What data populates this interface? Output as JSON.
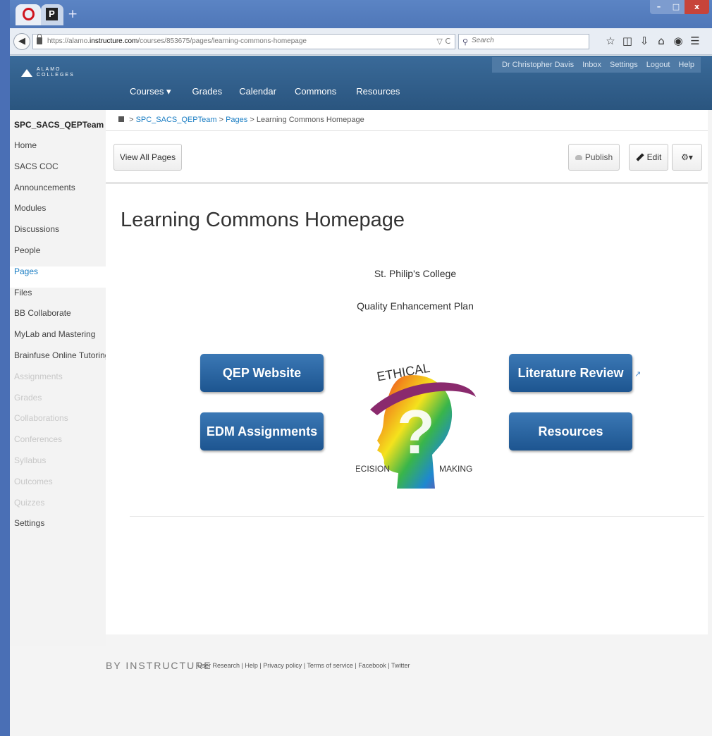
{
  "browser": {
    "tab_p_label": "P",
    "new_tab": "+",
    "window_controls": {
      "minimize": "–",
      "maximize": "□",
      "close": "x"
    },
    "url_prefix": "https://alamo.",
    "url_domain": "instructure.com",
    "url_path": "/courses/853675/pages/learning-commons-homepage",
    "url_controls": "▽ C",
    "search_placeholder": "Search",
    "back_icon": "back-arrow",
    "toolbar_icons": [
      "star-icon",
      "clipboard-icon",
      "download-icon",
      "home-icon",
      "pocket-icon",
      "menu-icon"
    ]
  },
  "header": {
    "logo_text": "ALAMO\nCOLLEGES",
    "user_nav": [
      "Dr Christopher Davis",
      "Inbox",
      "Settings",
      "Logout",
      "Help"
    ],
    "main_nav": [
      "Courses ▾",
      "Grades",
      "Calendar",
      "Commons",
      "Resources"
    ]
  },
  "sidebar": {
    "course_title": "SPC_SACS_QEPTeam",
    "items": [
      {
        "label": "Home",
        "state": "normal"
      },
      {
        "label": "SACS COC",
        "state": "normal"
      },
      {
        "label": "Announcements",
        "state": "normal"
      },
      {
        "label": "Modules",
        "state": "normal"
      },
      {
        "label": "Discussions",
        "state": "normal"
      },
      {
        "label": "People",
        "state": "normal"
      },
      {
        "label": "Pages",
        "state": "active"
      },
      {
        "label": "Files",
        "state": "normal"
      },
      {
        "label": "BB Collaborate",
        "state": "normal"
      },
      {
        "label": "MyLab and Mastering",
        "state": "normal"
      },
      {
        "label": "Brainfuse Online Tutoring",
        "state": "normal"
      },
      {
        "label": "Assignments",
        "state": "hidden"
      },
      {
        "label": "Grades",
        "state": "hidden"
      },
      {
        "label": "Collaborations",
        "state": "hidden"
      },
      {
        "label": "Conferences",
        "state": "hidden"
      },
      {
        "label": "Syllabus",
        "state": "hidden"
      },
      {
        "label": "Outcomes",
        "state": "hidden"
      },
      {
        "label": "Quizzes",
        "state": "hidden"
      },
      {
        "label": "Settings",
        "state": "normal"
      }
    ]
  },
  "breadcrumbs": {
    "course": "SPC_SACS_QEPTeam",
    "section": "Pages",
    "current": "Learning Commons Homepage",
    "separator": ">"
  },
  "page_actions": {
    "view_all": "View All Pages",
    "publish": "Publish",
    "edit": "Edit",
    "gear": "⚙▾"
  },
  "page": {
    "title": "Learning Commons Homepage",
    "college": "St. Philip's College",
    "plan": "Quality Enhancement Plan",
    "buttons": {
      "qep_website": "QEP Website",
      "edm_assignments": "EDM Assignments",
      "literature_review": "Literature Review",
      "resources": "Resources"
    },
    "external_link_icon": "external-link-icon",
    "logo": {
      "top_word": "ETHICAL",
      "left_word": "DECISION",
      "right_word": "MAKING"
    }
  },
  "footer": {
    "brand": "BY INSTRUCTURE",
    "links": "User Research | Help | Privacy policy | Terms of service | Facebook | Twitter"
  },
  "colors": {
    "desktop": "#4a6fb5",
    "header": "#2f5c8a",
    "link": "#1a7dc3",
    "button": "#2a66a4"
  }
}
